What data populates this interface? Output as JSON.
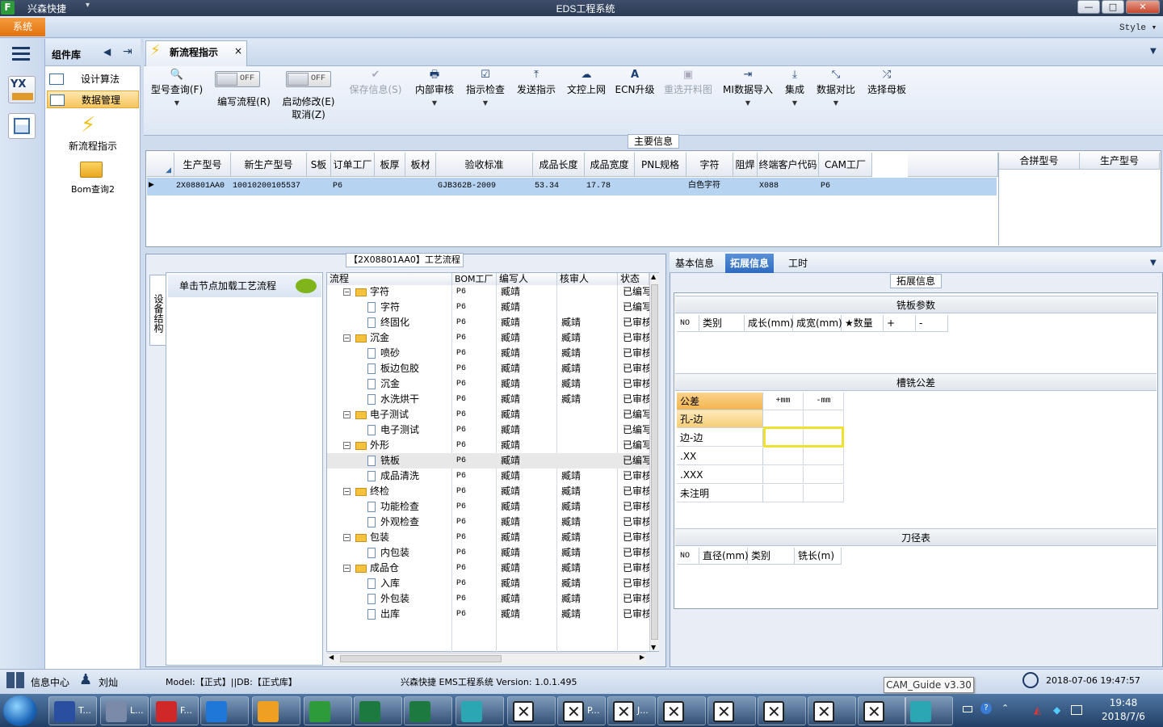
{
  "app": {
    "name": "兴森快捷",
    "window_title": "EDS工程系统",
    "menu_tab": "系统",
    "style_label": "Style"
  },
  "window_buttons": {
    "min": "—",
    "max": "□",
    "close": "✕"
  },
  "nav": {
    "title": "组件库",
    "items": [
      {
        "label": "设计算法"
      },
      {
        "label": "数据管理"
      }
    ],
    "tools": [
      {
        "label": "新流程指示"
      },
      {
        "label": "Bom查询2"
      }
    ]
  },
  "doc_tab": {
    "label": "新流程指示",
    "close": "×"
  },
  "ribbon": {
    "buttons": [
      {
        "label": "型号查询(F)",
        "icon": "search-icon",
        "glyph": "🔍",
        "dropdown": true,
        "disabled": false
      },
      {
        "label": "保存信息(S)",
        "icon": "check-icon",
        "glyph": "✔",
        "dropdown": false,
        "disabled": true
      },
      {
        "label": "内部审核",
        "icon": "printer-icon",
        "glyph": "🖶",
        "dropdown": true,
        "disabled": false
      },
      {
        "label": "指示检查",
        "icon": "checkbox-icon",
        "glyph": "☑",
        "dropdown": true,
        "disabled": false
      },
      {
        "label": "发送指示",
        "icon": "upload-icon",
        "glyph": "⤒",
        "dropdown": false,
        "disabled": false
      },
      {
        "label": "文控上网",
        "icon": "cloud-upload-icon",
        "glyph": "☁",
        "dropdown": false,
        "disabled": false
      },
      {
        "label": "ECN升级",
        "icon": "font-icon",
        "glyph": "A",
        "dropdown": false,
        "disabled": false
      },
      {
        "label": "重选开料图",
        "icon": "image-icon",
        "glyph": "▣",
        "dropdown": false,
        "disabled": true
      },
      {
        "label": "MI数据导入",
        "icon": "import-icon",
        "glyph": "⇥",
        "dropdown": true,
        "disabled": false
      },
      {
        "label": "集成",
        "icon": "download-icon",
        "glyph": "⤓",
        "dropdown": true,
        "disabled": false
      },
      {
        "label": "数据对比",
        "icon": "compress-icon",
        "glyph": "⤡",
        "dropdown": true,
        "disabled": false
      },
      {
        "label": "选择母板",
        "icon": "shuffle-icon",
        "glyph": "⤮",
        "dropdown": false,
        "disabled": false
      }
    ],
    "toggles": [
      {
        "label": "编写流程(R)",
        "state": "OFF"
      },
      {
        "label": "启动修改(E)",
        "label2": "取消(Z)",
        "state": "OFF"
      }
    ]
  },
  "main_info": {
    "title": "主要信息",
    "columns": [
      "生产型号",
      "新生产型号",
      "S板",
      "订单工厂",
      "板厚",
      "板材",
      "验收标准",
      "成品长度",
      "成品宽度",
      "PNL规格",
      "字符",
      "阻焊",
      "终端客户代码",
      "CAM工厂"
    ],
    "row": [
      "2X08801AA0",
      "10010200105537",
      "",
      "P6",
      "",
      "",
      "GJB362B-2009",
      "53.34",
      "17.78",
      "",
      "白色字符",
      "",
      "X088",
      "P6"
    ],
    "side_columns": [
      "合拼型号",
      "生产型号"
    ]
  },
  "process": {
    "title": "【2X08801AA0】工艺流程",
    "vertical_tab": "设备结构",
    "node_hint": "单击节点加载工艺流程",
    "columns": [
      "流程",
      "BOM工厂",
      "编写人",
      "核审人",
      "状态"
    ],
    "rows": [
      {
        "name": "字符",
        "level": 0,
        "bom": "P6",
        "w": "臧靖",
        "r": "",
        "s": "已编写"
      },
      {
        "name": "字符",
        "level": 1,
        "bom": "P6",
        "w": "臧靖",
        "r": "",
        "s": "已编写"
      },
      {
        "name": "终固化",
        "level": 1,
        "bom": "P6",
        "w": "臧靖",
        "r": "臧靖",
        "s": "已审核"
      },
      {
        "name": "沉金",
        "level": 0,
        "bom": "P6",
        "w": "臧靖",
        "r": "臧靖",
        "s": "已审核"
      },
      {
        "name": "喷砂",
        "level": 1,
        "bom": "P6",
        "w": "臧靖",
        "r": "臧靖",
        "s": "已审核"
      },
      {
        "name": "板边包胶",
        "level": 1,
        "bom": "P6",
        "w": "臧靖",
        "r": "臧靖",
        "s": "已审核"
      },
      {
        "name": "沉金",
        "level": 1,
        "bom": "P6",
        "w": "臧靖",
        "r": "臧靖",
        "s": "已审核"
      },
      {
        "name": "水洗烘干",
        "level": 1,
        "bom": "P6",
        "w": "臧靖",
        "r": "臧靖",
        "s": "已审核"
      },
      {
        "name": "电子测试",
        "level": 0,
        "bom": "P6",
        "w": "臧靖",
        "r": "",
        "s": "已编写"
      },
      {
        "name": "电子测试",
        "level": 1,
        "bom": "P6",
        "w": "臧靖",
        "r": "",
        "s": "已编写"
      },
      {
        "name": "外形",
        "level": 0,
        "bom": "P6",
        "w": "臧靖",
        "r": "",
        "s": "已编写"
      },
      {
        "name": "铣板",
        "level": 1,
        "bom": "P6",
        "w": "臧靖",
        "r": "",
        "s": "已编写",
        "selected": true
      },
      {
        "name": "成品清洗",
        "level": 1,
        "bom": "P6",
        "w": "臧靖",
        "r": "臧靖",
        "s": "已审核"
      },
      {
        "name": "终检",
        "level": 0,
        "bom": "P6",
        "w": "臧靖",
        "r": "臧靖",
        "s": "已审核"
      },
      {
        "name": "功能检查",
        "level": 1,
        "bom": "P6",
        "w": "臧靖",
        "r": "臧靖",
        "s": "已审核"
      },
      {
        "name": "外观检查",
        "level": 1,
        "bom": "P6",
        "w": "臧靖",
        "r": "臧靖",
        "s": "已审核"
      },
      {
        "name": "包装",
        "level": 0,
        "bom": "P6",
        "w": "臧靖",
        "r": "臧靖",
        "s": "已审核"
      },
      {
        "name": "内包装",
        "level": 1,
        "bom": "P6",
        "w": "臧靖",
        "r": "臧靖",
        "s": "已审核"
      },
      {
        "name": "成品仓",
        "level": 0,
        "bom": "P6",
        "w": "臧靖",
        "r": "臧靖",
        "s": "已审核"
      },
      {
        "name": "入库",
        "level": 1,
        "bom": "P6",
        "w": "臧靖",
        "r": "臧靖",
        "s": "已审核"
      },
      {
        "name": "外包装",
        "level": 1,
        "bom": "P6",
        "w": "臧靖",
        "r": "臧靖",
        "s": "已审核"
      },
      {
        "name": "出库",
        "level": 1,
        "bom": "P6",
        "w": "臧靖",
        "r": "臧靖",
        "s": "已审核"
      }
    ]
  },
  "right_panel": {
    "tabs": [
      "基本信息",
      "拓展信息",
      "工时"
    ],
    "active_tab": "拓展信息",
    "title": "拓展信息",
    "mill_params": {
      "title": "铣板参数",
      "columns": [
        "NO",
        "类别",
        "成长(mm)",
        "成宽(mm)",
        "★数量",
        "+",
        "-"
      ]
    },
    "slot_tolerance": {
      "title": "槽铣公差",
      "columns": [
        "公差",
        "+mm",
        "-mm"
      ],
      "rows": [
        "孔-边",
        "边-边",
        ".XX",
        ".XXX",
        "未注明"
      ]
    },
    "tool_table": {
      "title": "刀径表",
      "columns": [
        "NO",
        "直径(mm)",
        "类别",
        "铣长(m)"
      ]
    }
  },
  "status_bar": {
    "info_center": "信息中心",
    "user": "刘灿",
    "model_db": "Model:【正式】||DB:【正式库】",
    "system": "兴森快捷 EMS工程系统 Version: 1.0.1.495",
    "tooltip": "CAM_Guide v3.30",
    "datetime": "2018-07-06 19:47:57"
  },
  "taskbar": {
    "items": [
      {
        "label": "T...",
        "icon": "floppy-icon",
        "color": "#2a4fa0"
      },
      {
        "label": "L...",
        "icon": "keyboard-icon",
        "color": "#7a8aa8"
      },
      {
        "label": "F...",
        "icon": "swirl-icon",
        "color": "#d02828"
      },
      {
        "label": "",
        "icon": "ie-icon",
        "color": "#1f78d8"
      },
      {
        "label": "",
        "icon": "shell-icon",
        "color": "#f0a020"
      },
      {
        "label": "",
        "icon": "app-f-icon",
        "color": "#2e9b3b"
      },
      {
        "label": "",
        "icon": "excel-icon",
        "color": "#1d7a3e"
      },
      {
        "label": "",
        "icon": "excel-icon",
        "color": "#1d7a3e"
      },
      {
        "label": "",
        "icon": "eye-icon",
        "color": "#2aa7b3"
      },
      {
        "label": "",
        "icon": "x-window-icon",
        "color": "#fff"
      },
      {
        "label": "P...",
        "icon": "x-window-icon",
        "color": "#fff"
      },
      {
        "label": "J...",
        "icon": "x-window-icon",
        "color": "#fff"
      },
      {
        "label": "",
        "icon": "x-window-icon",
        "color": "#fff"
      },
      {
        "label": "",
        "icon": "x-window-icon",
        "color": "#fff"
      },
      {
        "label": "",
        "icon": "x-window-icon",
        "color": "#fff"
      },
      {
        "label": "",
        "icon": "x-window-icon",
        "color": "#fff"
      },
      {
        "label": "",
        "icon": "x-window-icon",
        "color": "#fff"
      },
      {
        "label": "",
        "icon": "eye-icon",
        "color": "#2aa7b3"
      }
    ],
    "time": "19:48",
    "date": "2018/7/6"
  }
}
